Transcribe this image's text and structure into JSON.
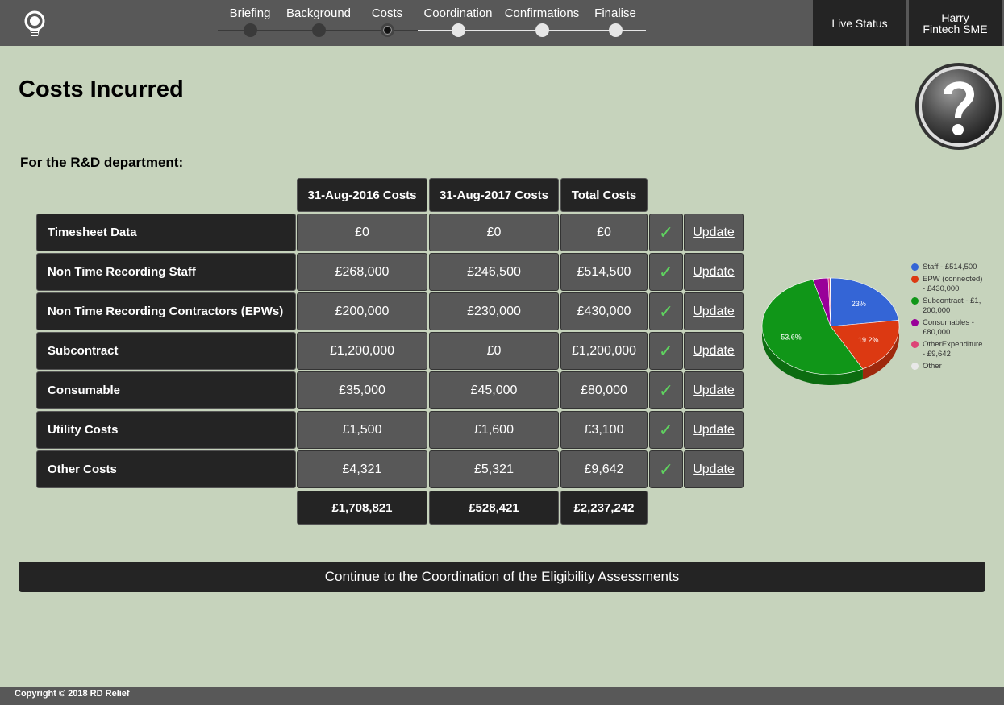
{
  "nav": {
    "steps": [
      {
        "label": "Briefing",
        "state": "done"
      },
      {
        "label": "Background",
        "state": "done"
      },
      {
        "label": "Costs",
        "state": "current"
      },
      {
        "label": "Coordination",
        "state": "todo"
      },
      {
        "label": "Confirmations",
        "state": "todo"
      },
      {
        "label": "Finalise",
        "state": "todo"
      }
    ],
    "live_status": "Live Status",
    "user_name": "Harry",
    "user_company": "Fintech SME"
  },
  "page": {
    "title": "Costs Incurred",
    "department_label": "For the R&D department:",
    "continue_label": "Continue to the Coordination of the Eligibility Assessments",
    "copyright": "Copyright © 2018 RD Relief"
  },
  "table": {
    "headers": [
      "31-Aug-2016 Costs",
      "31-Aug-2017 Costs",
      "Total Costs"
    ],
    "rows": [
      {
        "label": "Timesheet Data",
        "y2016": "£0",
        "y2017": "£0",
        "total": "£0",
        "check": "✓",
        "action": "Update"
      },
      {
        "label": "Non Time Recording Staff",
        "y2016": "£268,000",
        "y2017": "£246,500",
        "total": "£514,500",
        "check": "✓",
        "action": "Update"
      },
      {
        "label": "Non Time Recording Contractors (EPWs)",
        "y2016": "£200,000",
        "y2017": "£230,000",
        "total": "£430,000",
        "check": "✓",
        "action": "Update"
      },
      {
        "label": "Subcontract",
        "y2016": "£1,200,000",
        "y2017": "£0",
        "total": "£1,200,000",
        "check": "✓",
        "action": "Update"
      },
      {
        "label": "Consumable",
        "y2016": "£35,000",
        "y2017": "£45,000",
        "total": "£80,000",
        "check": "✓",
        "action": "Update"
      },
      {
        "label": "Utility Costs",
        "y2016": "£1,500",
        "y2017": "£1,600",
        "total": "£3,100",
        "check": "✓",
        "action": "Update"
      },
      {
        "label": "Other Costs",
        "y2016": "£4,321",
        "y2017": "£5,321",
        "total": "£9,642",
        "check": "✓",
        "action": "Update"
      }
    ],
    "totals": {
      "y2016": "£1,708,821",
      "y2017": "£528,421",
      "total": "£2,237,242"
    }
  },
  "colors": {
    "check": "#5fd35f",
    "staff": "#3465d6",
    "epw": "#dc3912",
    "subcontract": "#109618",
    "consumables": "#990099",
    "other_expenditure": "#dd4477",
    "other": "#e8e8e8"
  },
  "chart_data": {
    "type": "pie",
    "labels": [
      "Staff - £514,500",
      "EPW (connected) - £430,000",
      "Subcontract - £1, 200,000",
      "Consumables - £80,000",
      "OtherExpenditure - £9,642",
      "Other"
    ],
    "legend_lines": [
      [
        "Staff - £514,500"
      ],
      [
        "EPW (connected)",
        "- £430,000"
      ],
      [
        "Subcontract - £1,",
        "200,000"
      ],
      [
        "Consumables -",
        "£80,000"
      ],
      [
        "OtherExpenditure",
        "- £9,642"
      ],
      [
        "Other"
      ]
    ],
    "values": [
      514500,
      430000,
      1200000,
      80000,
      9642,
      3100
    ],
    "slice_labels": [
      "23%",
      "19.2%",
      "53.6%",
      "",
      "",
      ""
    ],
    "legend_position": "right"
  }
}
